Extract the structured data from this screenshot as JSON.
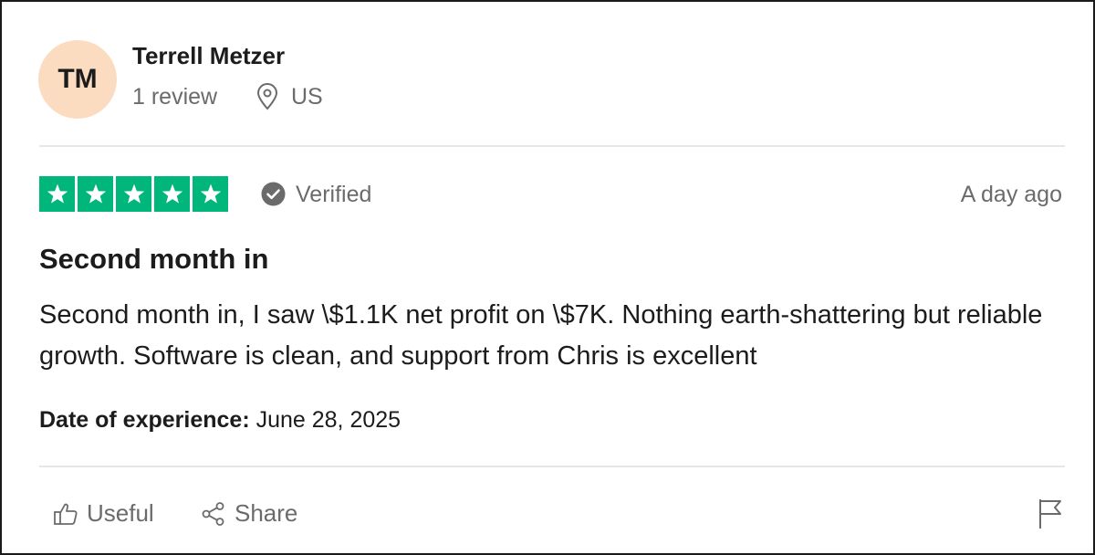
{
  "reviewer": {
    "initials": "TM",
    "name": "Terrell Metzer",
    "review_count": "1 review",
    "location": "US"
  },
  "rating": {
    "stars": 5,
    "max": 5,
    "star_color": "#00b67a"
  },
  "verified_label": "Verified",
  "review_date": "A day ago",
  "review": {
    "title": "Second month in",
    "body": "Second month in, I saw \\$1.1K net profit on \\$7K. Nothing earth-shattering but reliable growth. Software is clean, and support from Chris is excellent"
  },
  "experience": {
    "label": "Date of experience:",
    "date": "June 28, 2025"
  },
  "actions": {
    "useful_label": "Useful",
    "share_label": "Share"
  },
  "icons": {
    "location": "map-pin-icon",
    "verified": "check-circle-icon",
    "useful": "thumbs-up-icon",
    "share": "share-icon",
    "report": "flag-icon"
  },
  "colors": {
    "avatar_bg": "#fcdcc0",
    "muted_text": "#6b6b6b"
  }
}
